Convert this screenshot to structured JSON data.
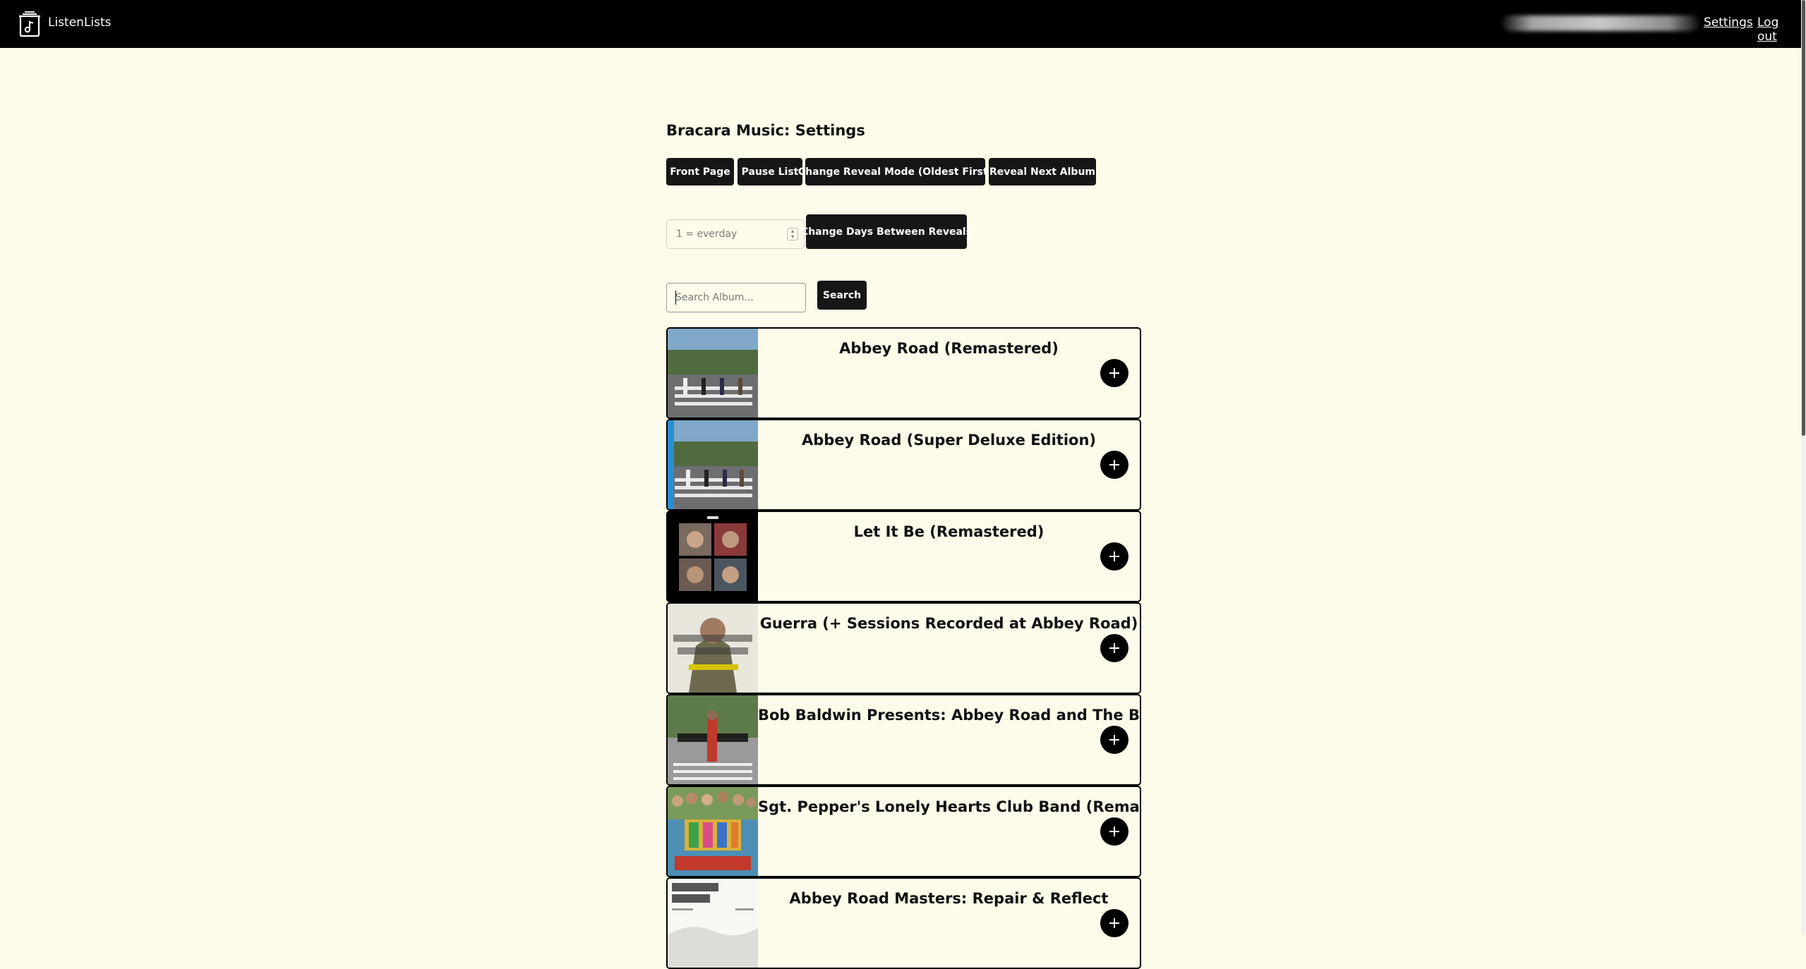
{
  "header": {
    "app_name": "ListenLists",
    "nav": {
      "settings_label": "Settings",
      "logout_label": "Log out"
    }
  },
  "page": {
    "title": "Bracara Music: Settings"
  },
  "actions": {
    "front_page": "Front Page",
    "pause_list": "Pause List",
    "change_reveal_mode": "Change Reveal Mode (Oldest First)",
    "reveal_next_album": "Reveal Next Album"
  },
  "reveal_days": {
    "placeholder": "1 = everday",
    "button_label": "Change Days Between Reveals"
  },
  "search": {
    "placeholder": "Search Album...",
    "button_label": "Search"
  },
  "albums": [
    {
      "title": "Abbey Road (Remastered)",
      "cover": "abbey-road-crosswalk"
    },
    {
      "title": "Abbey Road (Super Deluxe Edition)",
      "cover": "abbey-road-crosswalk-blue-band"
    },
    {
      "title": "Let It Be (Remastered)",
      "cover": "let-it-be-four-portraits"
    },
    {
      "title": "Guerra (+ Sessions Recorded at Abbey Road)",
      "cover": "guerra-portrait"
    },
    {
      "title": "Bob Baldwin Presents: Abbey Road and The Beatles",
      "cover": "bob-baldwin-crosswalk"
    },
    {
      "title": "Sgt. Pepper's Lonely Hearts Club Band (Remastered)",
      "cover": "sgt-pepper-collage"
    },
    {
      "title": "Abbey Road Masters: Repair & Reflect",
      "cover": "abbey-road-masters-white"
    }
  ],
  "colors": {
    "header_bg": "#000000",
    "page_bg": "#fdfbe9",
    "button_bg": "#161616",
    "button_text": "#ffffff"
  },
  "icons": [
    "listenlists-logo-icon",
    "add-icon"
  ]
}
